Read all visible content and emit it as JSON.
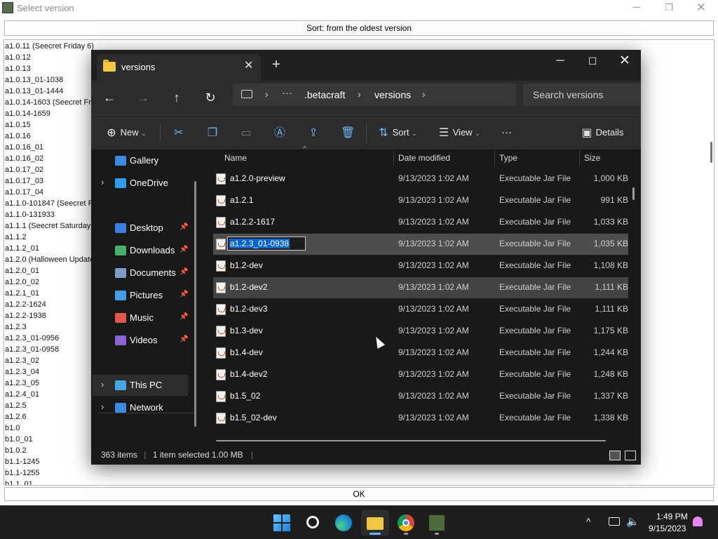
{
  "dialog": {
    "title": "Select version",
    "sort_label": "Sort: from the oldest version",
    "ok_label": "OK",
    "versions": [
      "a1.0.11 (Seecret Friday 6)",
      "a1.0.12",
      "a1.0.13",
      "a1.0.13_01-1038",
      "a1.0.13_01-1444",
      "a1.0.14-1603 (Seecret Friday 7)",
      "a1.0.14-1659",
      "a1.0.15",
      "a1.0.16",
      "a1.0.16_01",
      "a1.0.16_02",
      "a1.0.17_02",
      "a1.0.17_03",
      "a1.0.17_04",
      "a1.1.0-101847 (Seecret Friday 8)",
      "a1.1.0-131933",
      "a1.1.1 (Seecret Saturday 1)",
      "a1.1.2",
      "a1.1.2_01",
      "a1.2.0 (Halloween Update)",
      "a1.2.0_01",
      "a1.2.0_02",
      "a1.2.1_01",
      "a1.2.2-1624",
      "a1.2.2-1938",
      "a1.2.3",
      "a1.2.3_01-0956",
      "a1.2.3_01-0958",
      "a1.2.3_02",
      "a1.2.3_04",
      "a1.2.3_05",
      "a1.2.4_01",
      "a1.2.5",
      "a1.2.6",
      "b1.0",
      "b1.0_01",
      "b1.0.2",
      "b1.1-1245",
      "b1.1-1255",
      "b1.1_01"
    ]
  },
  "explorer": {
    "tab_title": "versions",
    "window_controls": {
      "minimize": "─",
      "maximize": "☐",
      "close": "✕"
    },
    "breadcrumb": {
      "more": "···",
      "items": [
        ".betacraft",
        "versions"
      ]
    },
    "search_placeholder": "Search versions",
    "toolbar": {
      "new_label": "New",
      "sort_label": "Sort",
      "view_label": "View",
      "more_label": "···",
      "details_label": "Details"
    },
    "sidebar": {
      "items": [
        {
          "label": "Gallery",
          "icon": "gallery-icon",
          "color": "#3d8be0"
        },
        {
          "label": "OneDrive",
          "icon": "onedrive-icon",
          "color": "#2f9bec"
        },
        {
          "label": "Desktop",
          "icon": "desktop-icon",
          "color": "#3c7ee0"
        },
        {
          "label": "Downloads",
          "icon": "download-icon",
          "color": "#49b26a"
        },
        {
          "label": "Documents",
          "icon": "documents-icon",
          "color": "#7c9bc7"
        },
        {
          "label": "Pictures",
          "icon": "pictures-icon",
          "color": "#3fa0e8"
        },
        {
          "label": "Music",
          "icon": "music-icon",
          "color": "#e4584d"
        },
        {
          "label": "Videos",
          "icon": "videos-icon",
          "color": "#8d63d8"
        },
        {
          "label": "This PC",
          "icon": "this-pc-icon",
          "color": "#46a5e4"
        },
        {
          "label": "Network",
          "icon": "network-icon",
          "color": "#3d8be0"
        }
      ]
    },
    "columns": {
      "name": "Name",
      "date": "Date modified",
      "type": "Type",
      "size": "Size"
    },
    "files": [
      {
        "name": "a1.2.0-preview",
        "date": "9/13/2023 1:02 AM",
        "type": "Executable Jar File",
        "size": "1,000 KB"
      },
      {
        "name": "a1.2.1",
        "date": "9/13/2023 1:02 AM",
        "type": "Executable Jar File",
        "size": "991 KB"
      },
      {
        "name": "a1.2.2-1617",
        "date": "9/13/2023 1:02 AM",
        "type": "Executable Jar File",
        "size": "1,033 KB"
      },
      {
        "name": "a1.2.3_01-0938",
        "date": "9/13/2023 1:02 AM",
        "type": "Executable Jar File",
        "size": "1,035 KB"
      },
      {
        "name": "b1.2-dev",
        "date": "9/13/2023 1:02 AM",
        "type": "Executable Jar File",
        "size": "1,108 KB"
      },
      {
        "name": "b1.2-dev2",
        "date": "9/13/2023 1:02 AM",
        "type": "Executable Jar File",
        "size": "1,111 KB"
      },
      {
        "name": "b1.2-dev3",
        "date": "9/13/2023 1:02 AM",
        "type": "Executable Jar File",
        "size": "1,111 KB"
      },
      {
        "name": "b1.3-dev",
        "date": "9/13/2023 1:02 AM",
        "type": "Executable Jar File",
        "size": "1,175 KB"
      },
      {
        "name": "b1.4-dev",
        "date": "9/13/2023 1:02 AM",
        "type": "Executable Jar File",
        "size": "1,244 KB"
      },
      {
        "name": "b1.4-dev2",
        "date": "9/13/2023 1:02 AM",
        "type": "Executable Jar File",
        "size": "1,248 KB"
      },
      {
        "name": "b1.5_02",
        "date": "9/13/2023 1:02 AM",
        "type": "Executable Jar File",
        "size": "1,337 KB"
      },
      {
        "name": "b1.5_02-dev",
        "date": "9/13/2023 1:02 AM",
        "type": "Executable Jar File",
        "size": "1,338 KB"
      }
    ],
    "renaming_index": 3,
    "hover_index": 5,
    "status": {
      "item_count": "363 items",
      "selection": "1 item selected",
      "size": "1.00 MB"
    }
  },
  "taskbar": {
    "apps": [
      "start-icon",
      "search-icon",
      "edge-icon",
      "file-explorer-icon",
      "chrome-icon",
      "minecraft-launcher-icon"
    ],
    "time": "1:49 PM",
    "date": "9/15/2023"
  }
}
